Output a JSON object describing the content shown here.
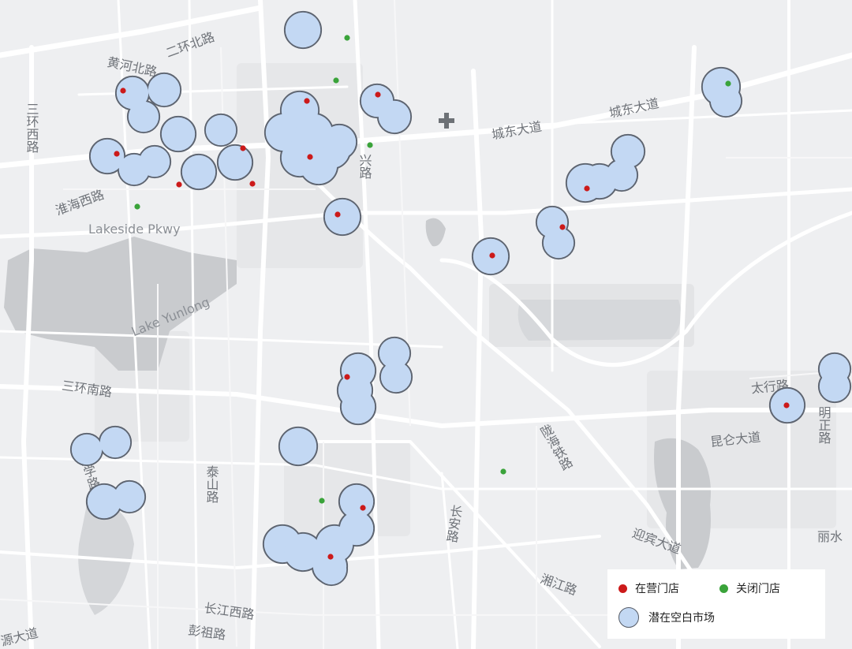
{
  "map": {
    "road_labels": {
      "erhuan_bei": "二环北路",
      "huanghe_bei": "黄河北路",
      "sanhuan_xi": "三环西路",
      "huaihai_xi": "淮海西路",
      "lakeside": "Lakeside Pkwy",
      "lake_yunlong": "Lake Yunlong",
      "xing_lu": "兴路",
      "chengdong_1": "城东大道",
      "chengdong_2": "城东大道",
      "sanhuan_nan": "三环南路",
      "taishan": "泰山路",
      "daxue": "大学路",
      "changan": "长安路",
      "longhai": "陇海铁路",
      "taihang": "太行路",
      "mingzheng": "明正路",
      "kunlun": "昆仑大道",
      "xiangjiang": "湘江路",
      "changjiang_xi": "长江西路",
      "pengcheng": "彭祖路",
      "yingbin": "迎宾大道",
      "lishui": "丽水",
      "yuanda": "源大道"
    },
    "colors": {
      "open": "#cc1a1a",
      "closed": "#3aa33a",
      "market_fill": "#c3d8f3",
      "market_stroke": "#5d6470",
      "road": "#ffffff",
      "water": "#bfc2c6"
    }
  },
  "legend": {
    "open_label": "在营门店",
    "closed_label": "关闭门店",
    "market_label": "潜在空白市场"
  }
}
